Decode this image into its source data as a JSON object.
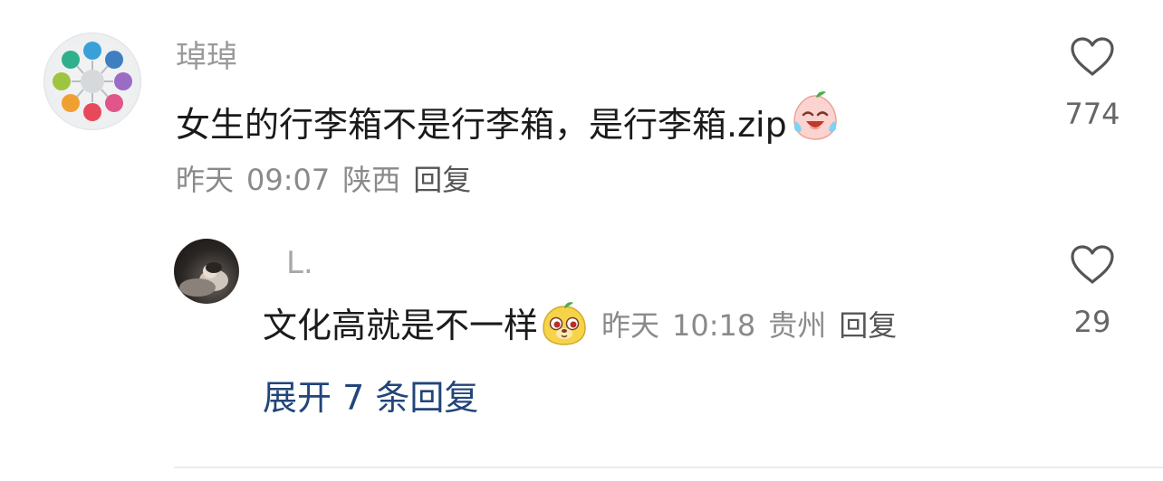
{
  "comment": {
    "username": "琸琸",
    "text": "女生的行李箱不是行李箱，是行李箱.zip",
    "emoji": "laughing-crying-peach-emoji",
    "date": "昨天",
    "time": "09:07",
    "location": "陕西",
    "reply_label": "回复",
    "like_count": "774"
  },
  "reply": {
    "username": "L.",
    "text": "文化高就是不一样",
    "emoji": "dog-face-emoji",
    "date": "昨天",
    "time": "10:18",
    "location": "贵州",
    "reply_label": "回复",
    "like_count": "29"
  },
  "expand_replies_label": "展开 7 条回复",
  "colors": {
    "link": "#22457a",
    "meta": "#8a8a8a",
    "username": "#9a9a9a"
  }
}
